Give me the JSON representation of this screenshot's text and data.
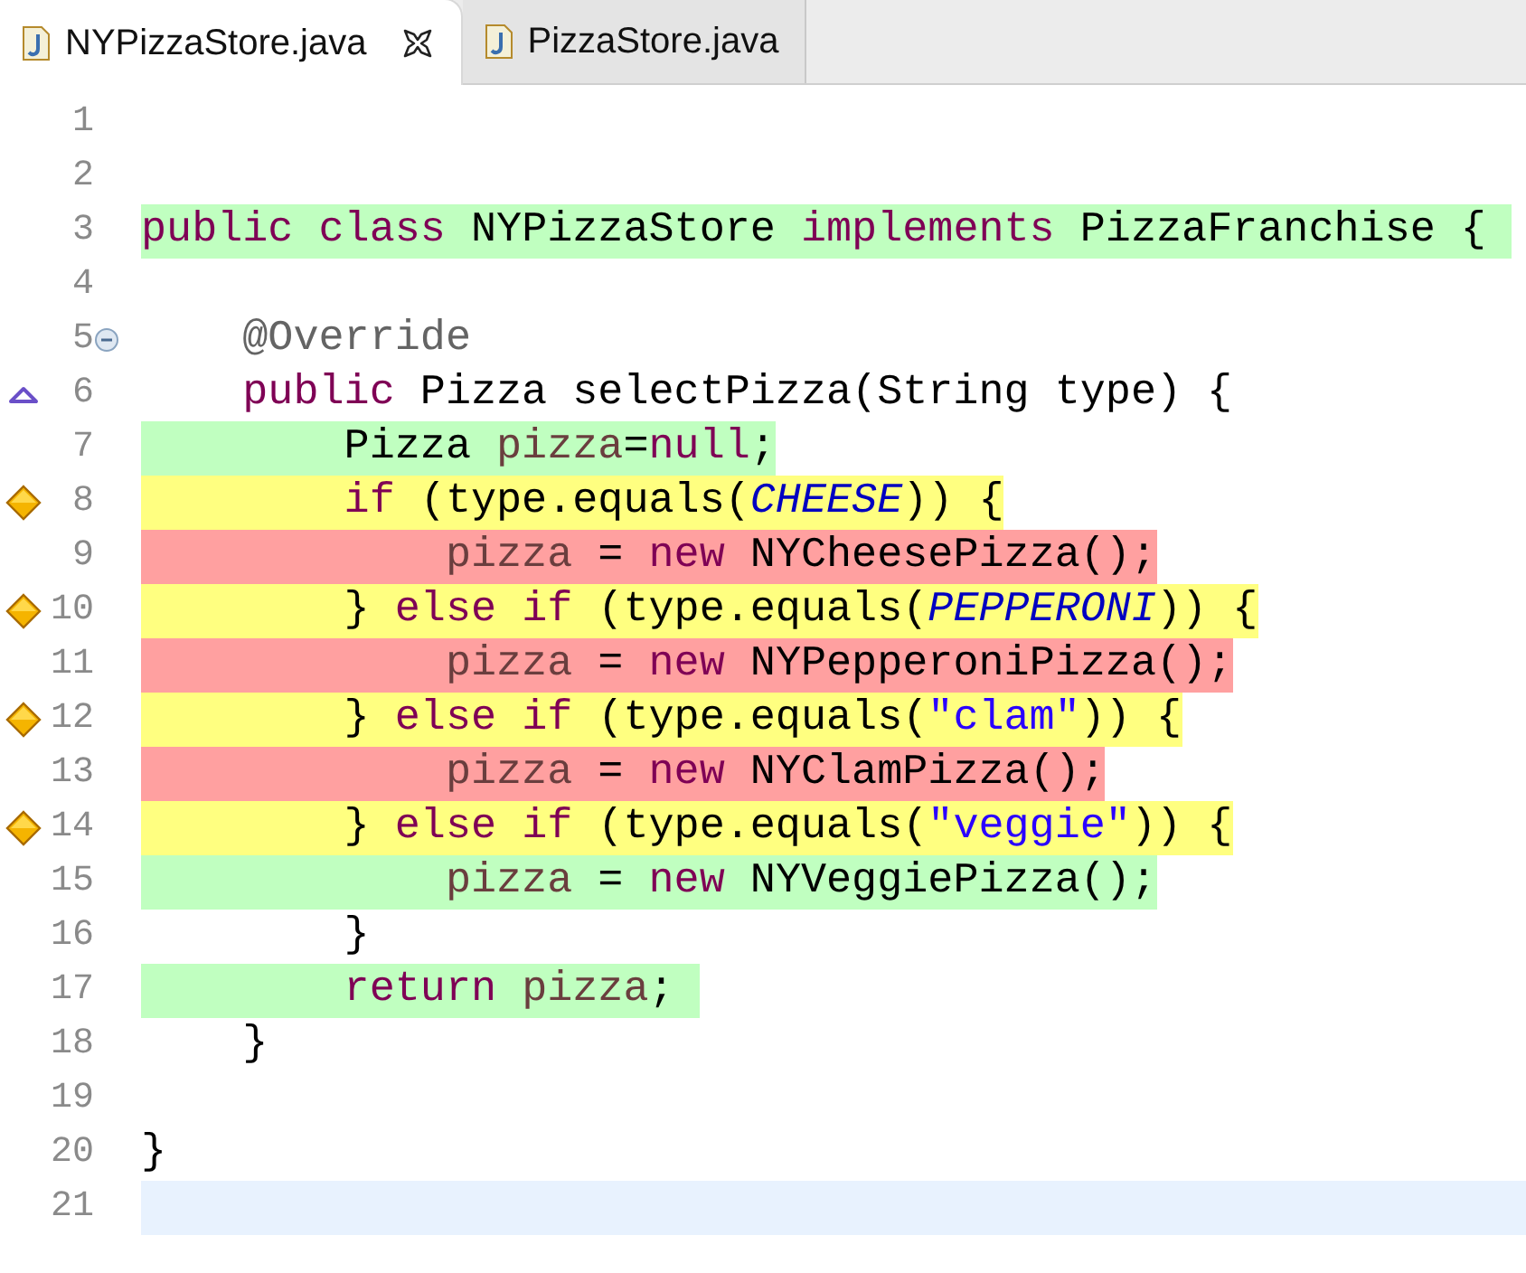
{
  "tabs": [
    {
      "label": "NYPizzaStore.java",
      "selected": true
    },
    {
      "label": "PizzaStore.java",
      "selected": false
    }
  ],
  "lines": [
    {
      "number": "1",
      "kind": "plain"
    },
    {
      "number": "2",
      "kind": "plain"
    },
    {
      "number": "3",
      "kind": "plain",
      "color": "#c0ffc0",
      "tokens": [
        {
          "kind": "keyword",
          "text": "public "
        },
        {
          "kind": "keyword",
          "text": "class"
        },
        {
          "kind": "plain",
          "text": " NYPizzaStore "
        },
        {
          "kind": "keyword",
          "text": "implements"
        },
        {
          "kind": "plain",
          "text": " PizzaFranchise { "
        }
      ]
    },
    {
      "number": "4",
      "kind": "plain"
    },
    {
      "number": "5",
      "kind": "fold",
      "tokens": [
        {
          "kind": "annotation",
          "text": "    @Override"
        }
      ]
    },
    {
      "number": "6",
      "kind": "override",
      "tokens": [
        {
          "kind": "keyword",
          "text": "    public"
        },
        {
          "kind": "plain",
          "text": " Pizza selectPizza(String type) {"
        }
      ]
    },
    {
      "number": "7",
      "kind": "plain",
      "color": "#c0ffc0",
      "tokens": [
        {
          "kind": "plain",
          "text": "        Pizza "
        },
        {
          "kind": "local",
          "text": "pizza"
        },
        {
          "kind": "plain",
          "text": "="
        },
        {
          "kind": "keyword",
          "text": "null"
        },
        {
          "kind": "plain",
          "text": ";"
        }
      ]
    },
    {
      "number": "8",
      "kind": "branch",
      "color": "#ffff80",
      "tokens": [
        {
          "kind": "keyword",
          "text": "        if"
        },
        {
          "kind": "plain",
          "text": " (type.equals("
        },
        {
          "kind": "field",
          "text": "CHEESE"
        },
        {
          "kind": "plain",
          "text": ")) {"
        }
      ]
    },
    {
      "number": "9",
      "kind": "plain",
      "color": "#ffa0a0",
      "tokens": [
        {
          "kind": "local",
          "text": "            pizza"
        },
        {
          "kind": "plain",
          "text": " = "
        },
        {
          "kind": "keyword",
          "text": "new"
        },
        {
          "kind": "plain",
          "text": " NYCheesePizza();"
        }
      ]
    },
    {
      "number": "10",
      "kind": "branch",
      "color": "#ffff80",
      "tokens": [
        {
          "kind": "plain",
          "text": "        } "
        },
        {
          "kind": "keyword",
          "text": "else "
        },
        {
          "kind": "keyword",
          "text": "if"
        },
        {
          "kind": "plain",
          "text": " (type.equals("
        },
        {
          "kind": "field",
          "text": "PEPPERONI"
        },
        {
          "kind": "plain",
          "text": ")) {"
        }
      ]
    },
    {
      "number": "11",
      "kind": "plain",
      "color": "#ffa0a0",
      "tokens": [
        {
          "kind": "local",
          "text": "            pizza"
        },
        {
          "kind": "plain",
          "text": " = "
        },
        {
          "kind": "keyword",
          "text": "new"
        },
        {
          "kind": "plain",
          "text": " NYPepperoniPizza();"
        }
      ]
    },
    {
      "number": "12",
      "kind": "branch",
      "color": "#ffff80",
      "tokens": [
        {
          "kind": "plain",
          "text": "        } "
        },
        {
          "kind": "keyword",
          "text": "else "
        },
        {
          "kind": "keyword",
          "text": "if"
        },
        {
          "kind": "plain",
          "text": " (type.equals("
        },
        {
          "kind": "string",
          "text": "\"clam\""
        },
        {
          "kind": "plain",
          "text": ")) {"
        }
      ]
    },
    {
      "number": "13",
      "kind": "plain",
      "color": "#ffa0a0",
      "tokens": [
        {
          "kind": "local",
          "text": "            pizza"
        },
        {
          "kind": "plain",
          "text": " = "
        },
        {
          "kind": "keyword",
          "text": "new"
        },
        {
          "kind": "plain",
          "text": " NYClamPizza();"
        }
      ]
    },
    {
      "number": "14",
      "kind": "branch",
      "color": "#ffff80",
      "tokens": [
        {
          "kind": "plain",
          "text": "        } "
        },
        {
          "kind": "keyword",
          "text": "else "
        },
        {
          "kind": "keyword",
          "text": "if"
        },
        {
          "kind": "plain",
          "text": " (type.equals("
        },
        {
          "kind": "string",
          "text": "\"veggie\""
        },
        {
          "kind": "plain",
          "text": ")) {"
        }
      ]
    },
    {
      "number": "15",
      "kind": "plain",
      "color": "#c0ffc0",
      "tokens": [
        {
          "kind": "local",
          "text": "            pizza"
        },
        {
          "kind": "plain",
          "text": " = "
        },
        {
          "kind": "keyword",
          "text": "new"
        },
        {
          "kind": "plain",
          "text": " NYVeggiePizza();"
        }
      ]
    },
    {
      "number": "16",
      "kind": "plain",
      "tokens": [
        {
          "kind": "plain",
          "text": "        }"
        }
      ]
    },
    {
      "number": "17",
      "kind": "plain",
      "color": "#c0ffc0",
      "tokens": [
        {
          "kind": "keyword",
          "text": "        return "
        },
        {
          "kind": "local",
          "text": "pizza"
        },
        {
          "kind": "plain",
          "text": "; "
        }
      ]
    },
    {
      "number": "18",
      "kind": "plain",
      "tokens": [
        {
          "kind": "plain",
          "text": "    }"
        }
      ]
    },
    {
      "number": "19",
      "kind": "plain"
    },
    {
      "number": "20",
      "kind": "plain",
      "tokens": [
        {
          "kind": "plain",
          "text": "}"
        }
      ]
    },
    {
      "number": "21",
      "kind": "current"
    }
  ]
}
